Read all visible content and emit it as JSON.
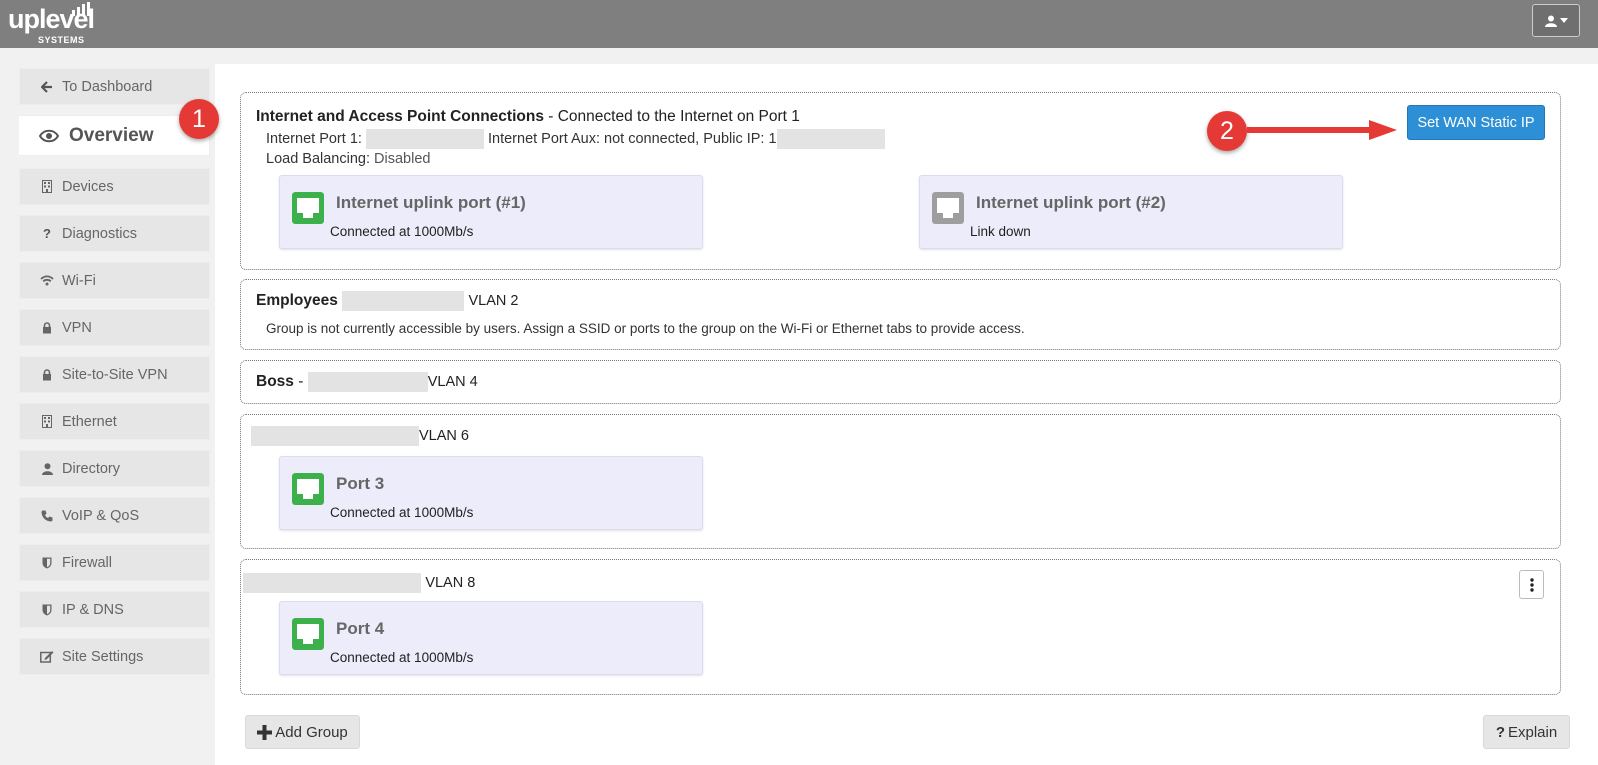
{
  "brand": {
    "name": "uplevel",
    "sub": "SYSTEMS"
  },
  "sidebar": {
    "items": [
      {
        "label": "To Dashboard",
        "icon": "arrow-left-icon"
      },
      {
        "label": "Overview",
        "icon": "eye-icon"
      },
      {
        "label": "Devices",
        "icon": "building-icon"
      },
      {
        "label": "Diagnostics",
        "icon": "question-icon"
      },
      {
        "label": "Wi-Fi",
        "icon": "wifi-icon"
      },
      {
        "label": "VPN",
        "icon": "lock-icon"
      },
      {
        "label": "Site-to-Site VPN",
        "icon": "lock-icon"
      },
      {
        "label": "Ethernet",
        "icon": "building-icon"
      },
      {
        "label": "Directory",
        "icon": "user-icon"
      },
      {
        "label": "VoIP & QoS",
        "icon": "phone-icon"
      },
      {
        "label": "Firewall",
        "icon": "shield-icon"
      },
      {
        "label": "IP & DNS",
        "icon": "shield-icon"
      },
      {
        "label": "Site Settings",
        "icon": "edit-icon"
      }
    ]
  },
  "internet": {
    "title": "Internet and Access Point Connections",
    "subtitle": " - Connected to the Internet on Port 1",
    "port1_label": "Internet Port 1:",
    "aux_label": "Internet Port Aux: not connected, Public IP:",
    "public_ip_first": "1",
    "lb_label": "Load Balancing:",
    "lb_value": "Disabled",
    "wan_button": "Set WAN Static IP",
    "ports": [
      {
        "title": "Internet uplink port (#1)",
        "status": "Connected at 1000Mb/s",
        "state_color": "#3cb04a"
      },
      {
        "title": "Internet uplink port (#2)",
        "status": "Link down",
        "state_color": "#9e9e9e"
      }
    ]
  },
  "groups": [
    {
      "name": "Employees",
      "vlan": "VLAN 2",
      "note": "Group is not currently accessible by users. Assign a SSID or ports to the group on the Wi-Fi or Ethernet tabs to provide access."
    },
    {
      "name": "Boss",
      "separator": "-",
      "vlan": "VLAN 4"
    },
    {
      "vlan": "VLAN 6",
      "port": {
        "title": "Port 3",
        "status": "Connected at 1000Mb/s"
      }
    },
    {
      "vlan": "VLAN 8",
      "port": {
        "title": "Port 4",
        "status": "Connected at 1000Mb/s"
      }
    }
  ],
  "actions": {
    "add_group": "Add Group",
    "explain": "Explain"
  },
  "annotations": {
    "step1": "1",
    "step2": "2"
  }
}
